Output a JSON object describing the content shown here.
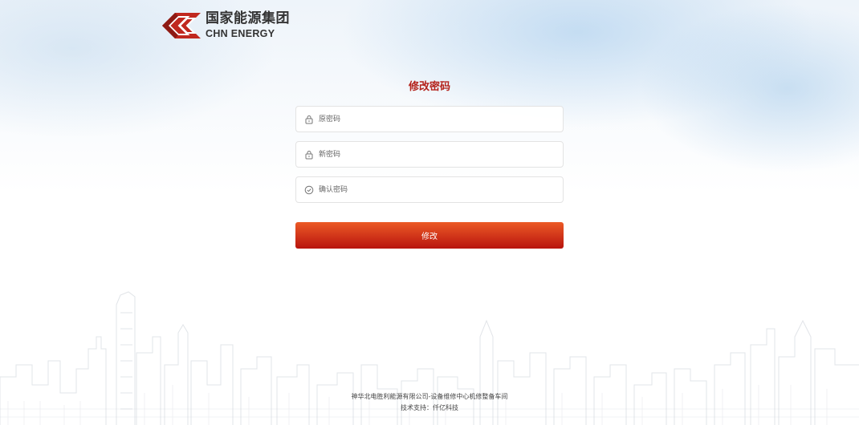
{
  "logo": {
    "cn": "国家能源集团",
    "en": "CHN ENERGY"
  },
  "page": {
    "title": "修改密码"
  },
  "form": {
    "old_password": {
      "placeholder": "原密码",
      "value": "",
      "icon": "lock-icon"
    },
    "new_password": {
      "placeholder": "新密码",
      "value": "",
      "icon": "lock-icon"
    },
    "confirm_password": {
      "placeholder": "确认密码",
      "value": "",
      "icon": "check-circle-icon"
    },
    "submit_label": "修改"
  },
  "footer": {
    "org": "神华北电胜利能源有限公司-设备维修中心机修整备车间",
    "support": "技术支持：仟亿科技"
  },
  "colors": {
    "accent": "#b4221b",
    "button_top": "#ec5a26",
    "button_bottom": "#b8140e"
  }
}
